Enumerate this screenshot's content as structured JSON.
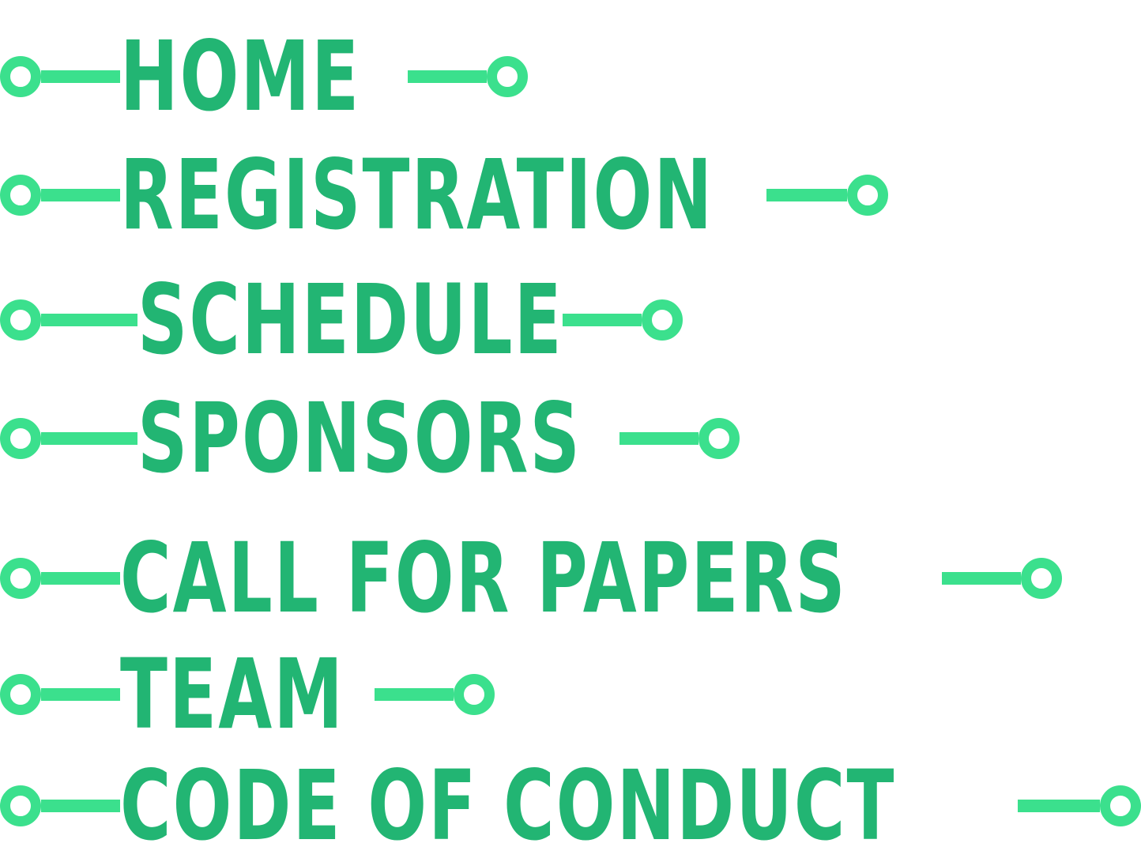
{
  "colors": {
    "text": "#22b573",
    "accent": "#3be08d",
    "background": "#ffffff"
  },
  "nav": {
    "items": [
      {
        "label": "HOME",
        "icon_left": "circuit-node-icon",
        "icon_right": "circuit-node-icon"
      },
      {
        "label": "REGISTRATION",
        "icon_left": "circuit-node-icon",
        "icon_right": "circuit-node-icon"
      },
      {
        "label": "SCHEDULE",
        "icon_left": "circuit-node-icon",
        "icon_right": "circuit-node-icon"
      },
      {
        "label": "SPONSORS",
        "icon_left": "circuit-node-icon",
        "icon_right": "circuit-node-icon"
      },
      {
        "label": "CALL FOR PAPERS",
        "icon_left": "circuit-node-icon",
        "icon_right": "circuit-node-icon"
      },
      {
        "label": "TEAM",
        "icon_left": "circuit-node-icon",
        "icon_right": "circuit-node-icon"
      },
      {
        "label": "CODE OF CONDUCT",
        "icon_left": "circuit-node-icon",
        "icon_right": "circuit-node-icon"
      }
    ]
  }
}
